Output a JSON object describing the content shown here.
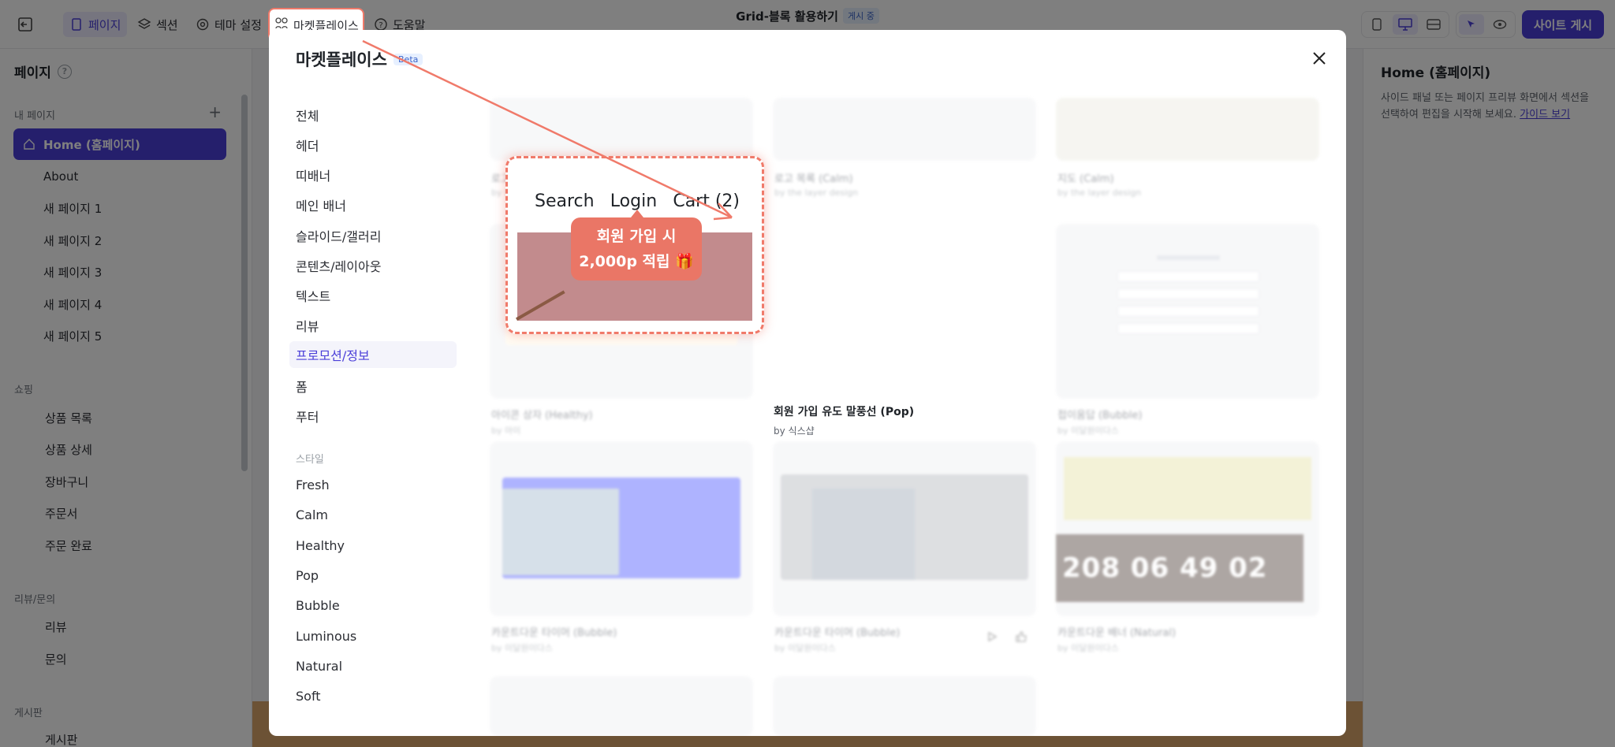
{
  "topbar": {
    "nav": [
      {
        "label": "페이지",
        "icon": "page-icon",
        "active": true
      },
      {
        "label": "섹션",
        "icon": "layers-icon",
        "active": false
      },
      {
        "label": "테마 설정",
        "icon": "gear-icon",
        "active": false
      },
      {
        "label": "마켓플레이스",
        "icon": "marketplace-icon",
        "active": false
      },
      {
        "label": "도움말",
        "icon": "help-icon",
        "active": false
      }
    ],
    "title": "Grid-블록 활용하기",
    "status_badge": "게시 중",
    "subtitle": "",
    "publish_label": "사이트 게시"
  },
  "left_sidebar": {
    "title": "페이지",
    "my_pages_label": "내 페이지",
    "pages": [
      "Home (홈페이지)",
      "About",
      "새 페이지 1",
      "새 페이지 2",
      "새 페이지 3",
      "새 페이지 4",
      "새 페이지 5"
    ],
    "shopping_label": "쇼핑",
    "shopping": [
      "상품 목록",
      "상품 상세",
      "장바구니",
      "주문서",
      "주문 완료"
    ],
    "review_label": "리뷰/문의",
    "review": [
      "리뷰",
      "문의"
    ],
    "board_label": "게시판",
    "board": [
      "게시판"
    ]
  },
  "right_sidebar": {
    "title": "Home (홈페이지)",
    "desc": "사이드 패널 또는 페이지 프리뷰 화면에서 섹션을 선택하여 편집을 시작해 보세요.",
    "guide_link": "가이드 보기"
  },
  "modal": {
    "title": "마켓플레이스",
    "beta": "Beta",
    "categories": [
      "전체",
      "헤더",
      "띠배너",
      "메인 배너",
      "슬라이드/갤러리",
      "콘텐츠/레이아웃",
      "텍스트",
      "리뷰",
      "프로모션/정보",
      "폼",
      "푸터"
    ],
    "selected_category": "프로모션/정보",
    "style_label": "스타일",
    "styles": [
      "Fresh",
      "Calm",
      "Healthy",
      "Pop",
      "Bubble",
      "Luminous",
      "Natural",
      "Soft"
    ],
    "cards": [
      {
        "name": "로고 목록 (Calm)",
        "by": "by the layer design"
      },
      {
        "name": "로고 목록 (Calm)",
        "by": "by the layer design"
      },
      {
        "name": "지도 (Calm)",
        "by": "by the layer design"
      },
      {
        "name": "아이콘 상자 (Healthy)",
        "by": "by 아이"
      },
      {
        "name": "회원 가입 유도 말풍선 (Pop)",
        "by": "by 식스샵"
      },
      {
        "name": "접이움답 (Bubble)",
        "by": "by 이달원이다스"
      },
      {
        "name": "카운트다운 타이머 (Bubble)",
        "by": "by 이달원이다스"
      },
      {
        "name": "카운트다운 타이머 (Bubble)",
        "by": "by 이달원이다스"
      },
      {
        "name": "카운트다운 배너 (Natural)",
        "by": "by 이달원이다스"
      }
    ],
    "featured": {
      "nav": [
        "Search",
        "Login",
        "Cart (2)"
      ],
      "bubble_line1": "회원 가입 시",
      "bubble_line2": "2,000p 적립 🎁"
    },
    "countdown": "208 06 49 02"
  },
  "colors": {
    "accent": "#4b3fd9",
    "highlight": "#f07a6a",
    "bubble": "#ea7666"
  }
}
